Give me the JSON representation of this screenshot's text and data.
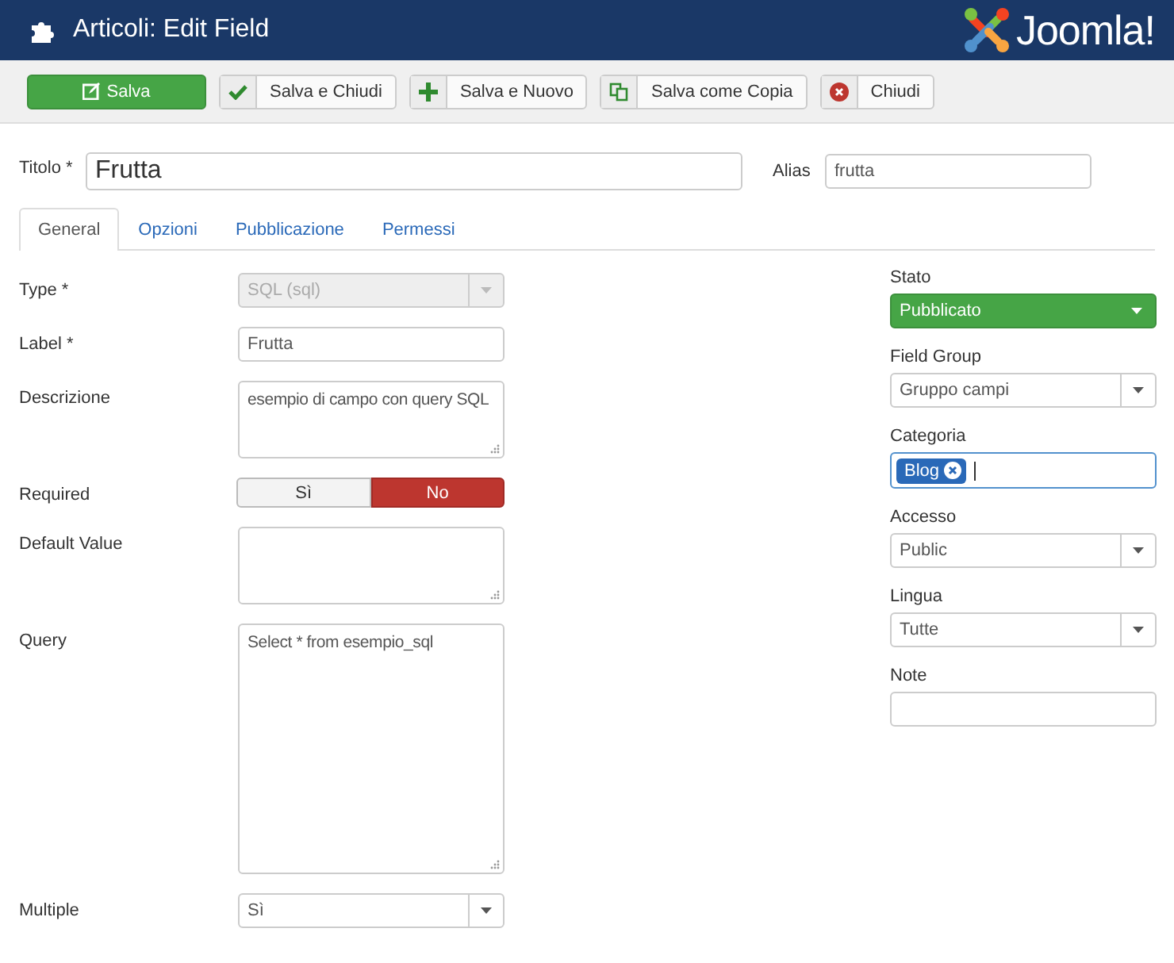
{
  "header": {
    "title": "Articoli: Edit Field",
    "logo_text": "Joomla!"
  },
  "toolbar": [
    {
      "label": "Salva",
      "kind": "primary"
    },
    {
      "label": "Salva e Chiudi",
      "kind": "default"
    },
    {
      "label": "Salva e Nuovo",
      "kind": "default"
    },
    {
      "label": "Salva come Copia",
      "kind": "default"
    },
    {
      "label": "Chiudi",
      "kind": "default"
    }
  ],
  "title_field": {
    "label": "Titolo *",
    "value": "Frutta"
  },
  "alias_field": {
    "label": "Alias",
    "value": "frutta"
  },
  "tabs": [
    {
      "label": "General",
      "selected": true
    },
    {
      "label": "Opzioni",
      "selected": false
    },
    {
      "label": "Pubblicazione",
      "selected": false
    },
    {
      "label": "Permessi",
      "selected": false
    }
  ],
  "fields": [
    {
      "label": "Type *",
      "kind": "select",
      "value": "SQL (sql)",
      "disabled": true
    },
    {
      "label": "Label *",
      "kind": "text",
      "value": "Frutta"
    },
    {
      "label": "Descrizione",
      "kind": "textarea",
      "value": "esempio di campo con query SQL"
    },
    {
      "label": "Required",
      "kind": "toggle",
      "options": [
        {
          "label": "Sì",
          "selected": false
        },
        {
          "label": "No",
          "selected": true
        }
      ]
    },
    {
      "label": "Default Value",
      "kind": "textarea"
    },
    {
      "label": "Query",
      "kind": "textarea",
      "value": "Select * from esempio_sql"
    },
    {
      "label": "Multiple",
      "kind": "select",
      "value": "Sì",
      "disabled": false
    }
  ],
  "side_fields": [
    {
      "label": "Stato",
      "kind": "status",
      "value": "Pubblicato"
    },
    {
      "label": "Field Group",
      "kind": "select",
      "value": "Gruppo campi"
    },
    {
      "label": "Categoria",
      "kind": "tags",
      "tags": [
        "Blog"
      ]
    },
    {
      "label": "Accesso",
      "kind": "select",
      "value": "Public"
    },
    {
      "label": "Lingua",
      "kind": "select",
      "value": "Tutte"
    },
    {
      "label": "Note",
      "kind": "text"
    }
  ]
}
